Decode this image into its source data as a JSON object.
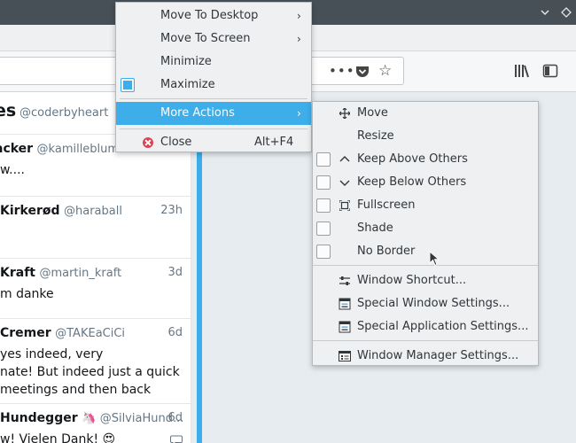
{
  "titlebar": {
    "minimize_icon": "chevron-down-icon",
    "close_icon": "diamond-icon"
  },
  "browser": {
    "more_glyph": "•••"
  },
  "feed": {
    "header_name": "es",
    "header_handle": "@coderbyheart",
    "tweets": [
      {
        "name": "acker",
        "handle": "@kamilleblumn",
        "time": "",
        "lines": [
          "w...."
        ]
      },
      {
        "name": "Kirkerød",
        "handle": "@haraball",
        "time": "23h",
        "lines": []
      },
      {
        "name": "Kraft",
        "handle": "@martin_kraft",
        "time": "3d",
        "lines": [
          "m danke"
        ]
      },
      {
        "name": "Cremer",
        "handle": "@TAKEaCiCi",
        "time": "6d",
        "lines": [
          "yes indeed, very",
          "nate! But indeed just a quick",
          "meetings and then back"
        ]
      },
      {
        "name": "Hundegger",
        "handle": "@SilviaHund...",
        "time": "6d",
        "lines": [
          "w! Vielen Dank! 😍"
        ]
      }
    ]
  },
  "window_menu": {
    "items": [
      {
        "label": "Move To Desktop"
      },
      {
        "label": "Move To Screen"
      },
      {
        "label": "Minimize"
      },
      {
        "label": "Maximize",
        "checked": true
      },
      {
        "label": "More Actions"
      },
      {
        "label": "Close",
        "shortcut": "Alt+F4"
      }
    ]
  },
  "submenu": {
    "items": [
      {
        "label": "Move"
      },
      {
        "label": "Resize"
      },
      {
        "label": "Keep Above Others"
      },
      {
        "label": "Keep Below Others"
      },
      {
        "label": "Fullscreen"
      },
      {
        "label": "Shade"
      },
      {
        "label": "No Border"
      },
      {
        "label": "Window Shortcut..."
      },
      {
        "label": "Special Window Settings..."
      },
      {
        "label": "Special Application Settings..."
      },
      {
        "label": "Window Manager Settings..."
      }
    ]
  },
  "colors": {
    "accent": "#3daee9",
    "close": "#da4453",
    "titlebar": "#475057"
  }
}
